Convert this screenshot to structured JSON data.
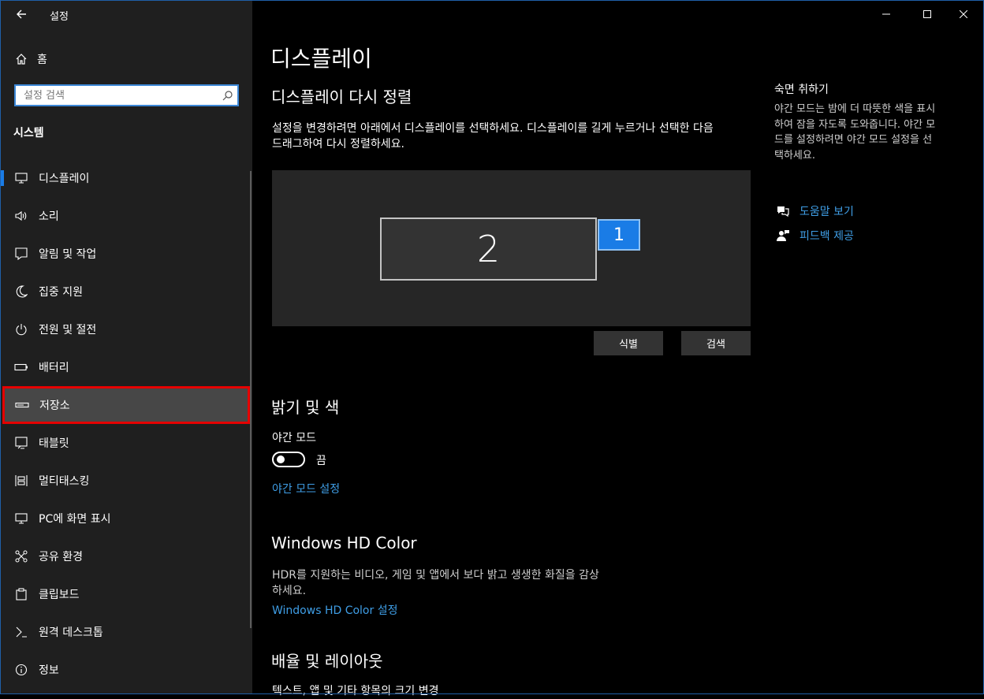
{
  "window": {
    "title": "설정"
  },
  "sidebar": {
    "home_label": "홈",
    "search_placeholder": "설정 검색",
    "section_title": "시스템",
    "items": [
      {
        "label": "디스플레이",
        "icon": "monitor-icon"
      },
      {
        "label": "소리",
        "icon": "speaker-icon"
      },
      {
        "label": "알림 및 작업",
        "icon": "notification-icon"
      },
      {
        "label": "집중 지원",
        "icon": "moon-icon"
      },
      {
        "label": "전원 및 절전",
        "icon": "power-icon"
      },
      {
        "label": "배터리",
        "icon": "battery-icon"
      },
      {
        "label": "저장소",
        "icon": "storage-icon"
      },
      {
        "label": "태블릿",
        "icon": "tablet-icon"
      },
      {
        "label": "멀티태스킹",
        "icon": "multitask-icon"
      },
      {
        "label": "PC에 화면 표시",
        "icon": "project-icon"
      },
      {
        "label": "공유 환경",
        "icon": "share-icon"
      },
      {
        "label": "클립보드",
        "icon": "clipboard-icon"
      },
      {
        "label": "원격 데스크톱",
        "icon": "remote-desktop-icon"
      },
      {
        "label": "정보",
        "icon": "info-icon"
      }
    ]
  },
  "main": {
    "page_title": "디스플레이",
    "rearrange": {
      "heading": "디스플레이 다시 정렬",
      "description_line1": "설정을 변경하려면 아래에서 디스플레이를 선택하세요. 디스플레이를 길게 누르거나 선택한 다음",
      "description_line2": "드래그하여 다시 정렬하세요.",
      "monitor_2": "2",
      "monitor_1": "1",
      "identify_button": "식별",
      "detect_button": "검색"
    },
    "brightness": {
      "heading": "밝기 및 색",
      "night_light_label": "야간 모드",
      "toggle_state": "끔",
      "night_light_settings_link": "야간 모드 설정"
    },
    "hd_color": {
      "heading": "Windows HD Color",
      "description_line1": "HDR를 지원하는 비디오, 게임 및 앱에서 보다 밝고 생생한 화질을 감상",
      "description_line2": "하세요.",
      "settings_link": "Windows HD Color 설정"
    },
    "scale": {
      "heading": "배율 및 레이아웃",
      "partial_text": "텍스트, 앱 및 기타 항목의 크기 변경"
    }
  },
  "right_panel": {
    "tip_title": "숙면 취하기",
    "tip_line1": "야간 모드는 밤에 더 따뜻한 색을 표시",
    "tip_line2": "하여 잠을 자도록 도와줍니다. 야간 모",
    "tip_line3": "드를 설정하려면 야간 모드 설정을 선",
    "tip_line4": "택하세요.",
    "help_link": "도움말 보기",
    "feedback_link": "피드백 제공"
  },
  "colors": {
    "accent": "#1a7ce6",
    "link": "#3f9ee6",
    "highlight_border": "#e50000"
  }
}
